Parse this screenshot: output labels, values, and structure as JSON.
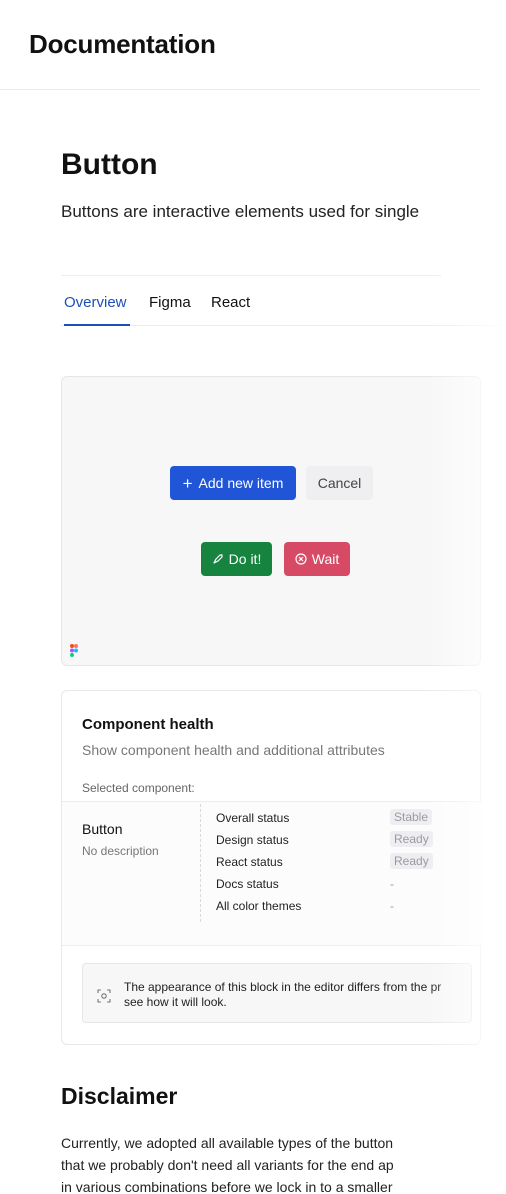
{
  "topbar": {
    "title": "Documentation"
  },
  "page": {
    "title": "Button",
    "subtitle": "Buttons are interactive elements used for single"
  },
  "tabs": [
    {
      "label": "Overview",
      "active": true
    },
    {
      "label": "Figma",
      "active": false
    },
    {
      "label": "React",
      "active": false
    }
  ],
  "preview": {
    "primary_button": "Add new item",
    "cancel_button": "Cancel",
    "success_button": "Do it!",
    "danger_button": "Wait",
    "colors": {
      "primary": "#1f55d6",
      "success": "#16843f",
      "danger": "#d64a66"
    }
  },
  "health": {
    "title": "Component health",
    "subtitle": "Show component health and additional attributes",
    "selected_label": "Selected component:",
    "component": {
      "name": "Button",
      "description": "No description"
    },
    "attributes": [
      {
        "label": "Overall status",
        "value": "Stable"
      },
      {
        "label": "Design status",
        "value": "Ready"
      },
      {
        "label": "React status",
        "value": "Ready"
      },
      {
        "label": "Docs status",
        "value": "-"
      },
      {
        "label": "All color themes",
        "value": "-"
      }
    ],
    "notice": "The appearance of this block in the editor differs from the pr\nsee how it will look."
  },
  "disclaimer": {
    "title": "Disclaimer",
    "text": "Currently, we adopted all available types of the button\nthat we probably don't need all variants for the end ap\nin various combinations before we lock in to a smaller"
  }
}
